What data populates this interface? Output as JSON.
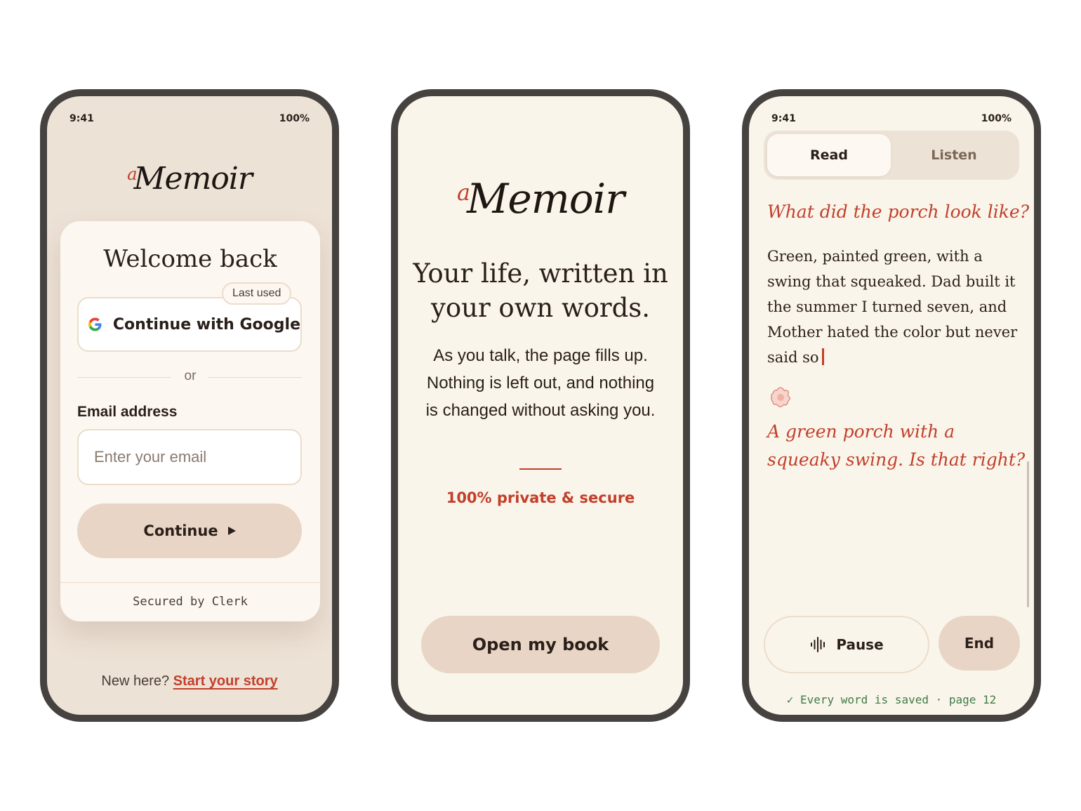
{
  "colors": {
    "accent_red": "#c23f2b",
    "success_green": "#3f7a47",
    "button_beige": "#e8d5c5",
    "frame": "#454240"
  },
  "signin_screen": {
    "status": {
      "time": "9:41",
      "battery": "100%"
    },
    "logo": {
      "prefix": "a",
      "name": "Memoir"
    },
    "title": "Welcome back",
    "google_button": "Continue with Google",
    "last_used_badge": "Last used",
    "divider_text": "or",
    "email_label": "Email address",
    "email_placeholder": "Enter your email",
    "continue_button": "Continue",
    "continue_icon": "play-arrow-icon",
    "footer": "Secured by Clerk",
    "new_here_text": "New here?",
    "start_link": "Start your story"
  },
  "intro_screen": {
    "logo": {
      "prefix": "a",
      "name": "Memoir"
    },
    "headline_line1": "Your life, written in",
    "headline_line2": "your own words.",
    "body": "As you talk, the page fills up. Nothing is left out, and nothing is changed without asking you.",
    "privacy": "100% private & secure",
    "cta": "Open my book"
  },
  "session_screen": {
    "status": {
      "time": "9:41",
      "battery": "100%"
    },
    "tabs": {
      "read": "Read",
      "listen": "Listen",
      "active": "Read"
    },
    "question": "What did the porch look like?",
    "answer": "Green, painted green, with a swing that squeaked. Dad built it the summer I turned seven, and Mother hated the color but never said so",
    "reply": "A green porch with a squeaky swing. Is that right?",
    "pause_button": "Pause",
    "pause_icon": "audio-waveform-icon",
    "end_button": "End",
    "saved_status": "✓ Every word is saved · page 12"
  }
}
